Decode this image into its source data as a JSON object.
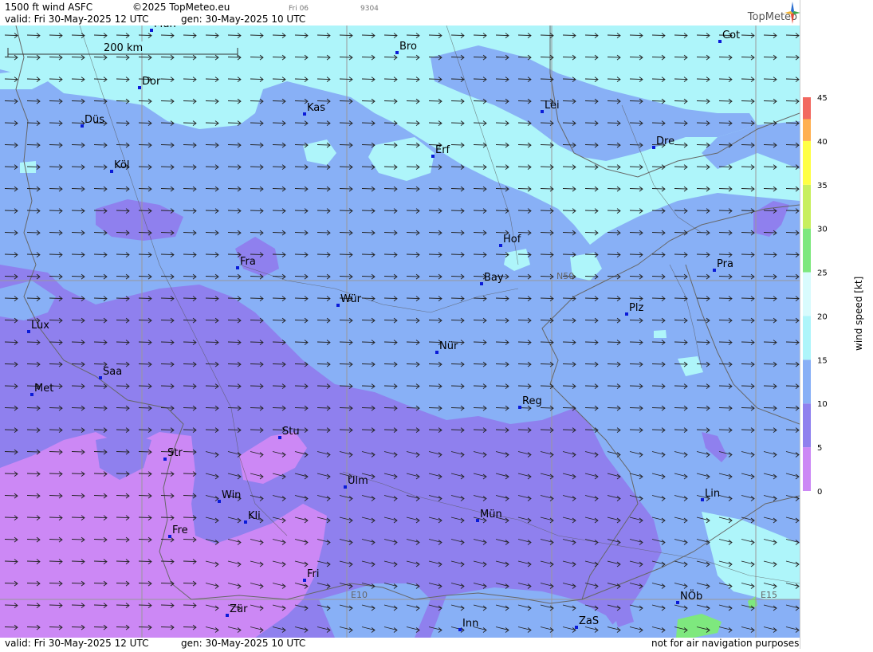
{
  "header": {
    "title": "1500 ft wind ASFC",
    "copyright": "©2025 TopMeteo.eu",
    "day_code": "Fri 06",
    "run_code": "9304",
    "valid": "valid:  Fri  30-May-2025  12 UTC",
    "gen": "gen:  30-May-2025 10 UTC",
    "logo": "TopMeteo"
  },
  "map": {
    "scale_label": "200 km",
    "grid_labels": [
      "N50",
      "E10",
      "E15"
    ],
    "cities": [
      {
        "name": "Mün",
        "id": "munich-top"
      },
      {
        "name": "Bro"
      },
      {
        "name": "Cot"
      },
      {
        "name": "Dor"
      },
      {
        "name": "Kas"
      },
      {
        "name": "Lei"
      },
      {
        "name": "Düs"
      },
      {
        "name": "Erf"
      },
      {
        "name": "Dre"
      },
      {
        "name": "Köl"
      },
      {
        "name": "Hof"
      },
      {
        "name": "Fra"
      },
      {
        "name": "Pra"
      },
      {
        "name": "Bay"
      },
      {
        "name": "Wür"
      },
      {
        "name": "Plz"
      },
      {
        "name": "Lux"
      },
      {
        "name": "Nür"
      },
      {
        "name": "Saa"
      },
      {
        "name": "Met"
      },
      {
        "name": "Reg"
      },
      {
        "name": "Stu"
      },
      {
        "name": "Str"
      },
      {
        "name": "Ulm"
      },
      {
        "name": "Win"
      },
      {
        "name": "Lin"
      },
      {
        "name": "Mün"
      },
      {
        "name": "Kli"
      },
      {
        "name": "Fre"
      },
      {
        "name": "Fri"
      },
      {
        "name": "NÖb"
      },
      {
        "name": "Zür"
      },
      {
        "name": "Inn"
      },
      {
        "name": "ZaS"
      }
    ]
  },
  "legend": {
    "title": "wind speed [kt]",
    "ticks": [
      "0",
      "5",
      "10",
      "15",
      "20",
      "25",
      "30",
      "35",
      "40",
      "45"
    ],
    "colors": [
      "#cc88f5",
      "#8f80ee",
      "#88b0f6",
      "#aef5fa",
      "#d8fbfd",
      "#7ee87e",
      "#c8ef5e",
      "#ffff44",
      "#ffb050",
      "#f26860"
    ]
  },
  "footer": {
    "valid": "valid:  Fri  30-May-2025  12 UTC",
    "gen": "gen:  30-May-2025 10 UTC",
    "disclaimer": "not for air navigation purposes"
  }
}
